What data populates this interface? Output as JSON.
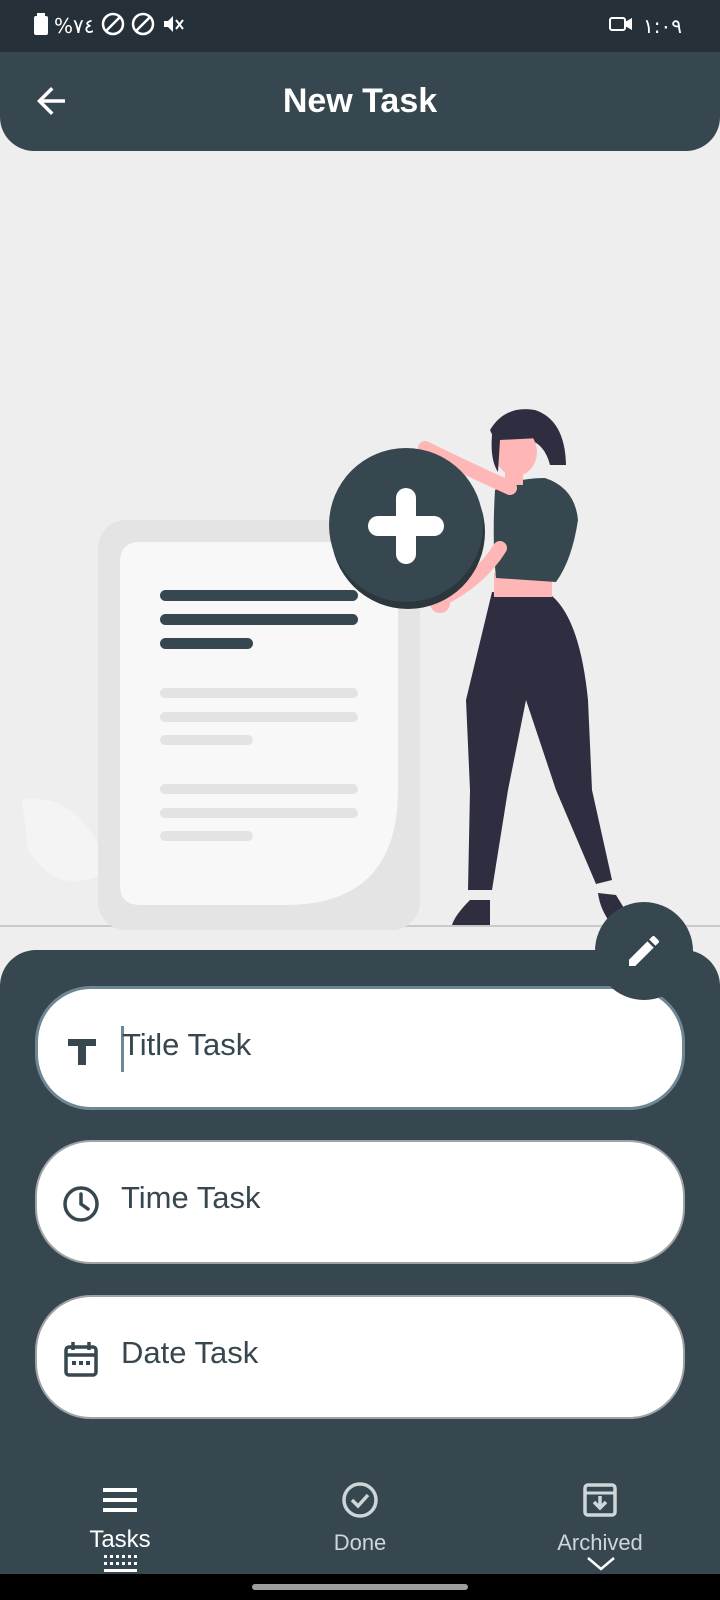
{
  "status_bar": {
    "battery_text": "%٧٤",
    "time": "١:٠٩"
  },
  "app_bar": {
    "title": "New Task"
  },
  "form": {
    "title_placeholder": "Title Task",
    "time_placeholder": "Time Task",
    "date_placeholder": "Date Task"
  },
  "bottom_nav": {
    "items": [
      {
        "label": "Tasks",
        "icon": "menu-icon",
        "selected": true
      },
      {
        "label": "Done",
        "icon": "check-circle-icon",
        "selected": false
      },
      {
        "label": "Archived",
        "icon": "archive-icon",
        "selected": false
      }
    ]
  },
  "colors": {
    "primary": "#37474f",
    "status_bar": "#263038",
    "background": "#eeeeee"
  }
}
